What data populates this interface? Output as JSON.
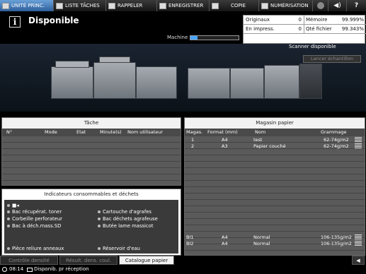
{
  "topbar": {
    "tabs": [
      {
        "label": "UNITÉ PRINC.",
        "icon": "printer-icon"
      },
      {
        "label": "LISTE TÂCHES",
        "icon": "list-icon"
      },
      {
        "label": "RAPPELER",
        "icon": "recall-icon"
      },
      {
        "label": "ENREGISTRER",
        "icon": "save-icon"
      },
      {
        "label": "COPIE",
        "icon": "copy-icon"
      },
      {
        "label": "NUMÉRISATION",
        "icon": "scan-icon"
      }
    ],
    "extra_icons": [
      "globe-icon",
      "speaker-icon",
      "help-icon"
    ],
    "help_label": "?"
  },
  "header": {
    "info_glyph": "i",
    "title": "Disponible",
    "machine_label": "Machine",
    "machine_progress": 0.15
  },
  "counters": {
    "originaux_label": "Originaux",
    "originaux_value": "0",
    "memoire_label": "Mémoire",
    "memoire_value": "99.999%",
    "impress_label": "En impress.",
    "impress_value": "0",
    "qte_label": "Qté fichier",
    "qte_value": "99.343%"
  },
  "scanner": {
    "status": "Scanner disponible",
    "sample_button": "Lancer échantillon"
  },
  "tache": {
    "title": "Tâche",
    "columns": [
      "N°",
      "Mode",
      "Etat",
      "Minute(s)",
      "Nom utilisateur"
    ]
  },
  "indicators": {
    "title": "Indicateurs consommables et déchets",
    "items": [
      "Bac récupérat. toner",
      "Corbeille perforateur",
      "Bac à déch.mass.SD",
      "Cartouche d'agrafes",
      "Bac déchets agrafeuse",
      "Butée lame massicot",
      "Pièce reliure anneaux",
      "Réservoir d'eau"
    ]
  },
  "magasin": {
    "title": "Magasin papier",
    "columns": [
      "Magas.",
      "Format (mm)",
      "Nom",
      "Grammage"
    ],
    "rows": [
      {
        "tray": "1",
        "format": "A4",
        "name": "test",
        "weight": "62-74g/m2"
      },
      {
        "tray": "2",
        "format": "A3",
        "name": "Papier couché",
        "weight": "62-74g/m2"
      },
      {
        "tray": "BI1",
        "format": "A4",
        "name": "Normal",
        "weight": "106-135g/m2"
      },
      {
        "tray": "BI2",
        "format": "A4",
        "name": "Normal",
        "weight": "106-135g/m2"
      }
    ]
  },
  "bottom_tabs": [
    "Contrôle densité",
    "Résult. dens. coul.",
    "Catalogue papier"
  ],
  "statusbar": {
    "time": "08:14",
    "message": "Disponib. pr réception"
  },
  "colors": {
    "accent": "#49a4ff",
    "selected_tab": "#2d5f9c"
  }
}
